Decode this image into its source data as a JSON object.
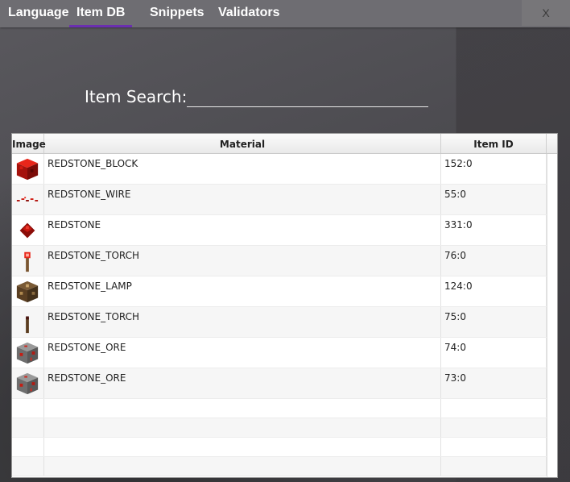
{
  "tabs": [
    {
      "label": "Language",
      "active": false
    },
    {
      "label": "Item DB",
      "active": true
    },
    {
      "label": "Snippets",
      "active": false
    },
    {
      "label": "Validators",
      "active": false
    }
  ],
  "close_label": "X",
  "search": {
    "label": "Item Search:",
    "value": ""
  },
  "table": {
    "headers": {
      "image": "Image",
      "material": "Material",
      "item_id": "Item ID"
    },
    "rows": [
      {
        "icon": "redstone-block-icon",
        "material": "REDSTONE_BLOCK",
        "item_id": "152:0"
      },
      {
        "icon": "redstone-wire-icon",
        "material": "REDSTONE_WIRE",
        "item_id": "55:0"
      },
      {
        "icon": "redstone-dust-icon",
        "material": "REDSTONE",
        "item_id": "331:0"
      },
      {
        "icon": "redstone-torch-on-icon",
        "material": "REDSTONE_TORCH",
        "item_id": "76:0"
      },
      {
        "icon": "redstone-lamp-icon",
        "material": "REDSTONE_LAMP",
        "item_id": "124:0"
      },
      {
        "icon": "redstone-torch-off-icon",
        "material": "REDSTONE_TORCH",
        "item_id": "75:0"
      },
      {
        "icon": "redstone-ore-icon",
        "material": "REDSTONE_ORE",
        "item_id": "74:0"
      },
      {
        "icon": "redstone-ore-icon",
        "material": "REDSTONE_ORE",
        "item_id": "73:0"
      }
    ]
  },
  "colors": {
    "tab_accent": "#6b2fb0",
    "tabbar": "#6e6d72"
  }
}
